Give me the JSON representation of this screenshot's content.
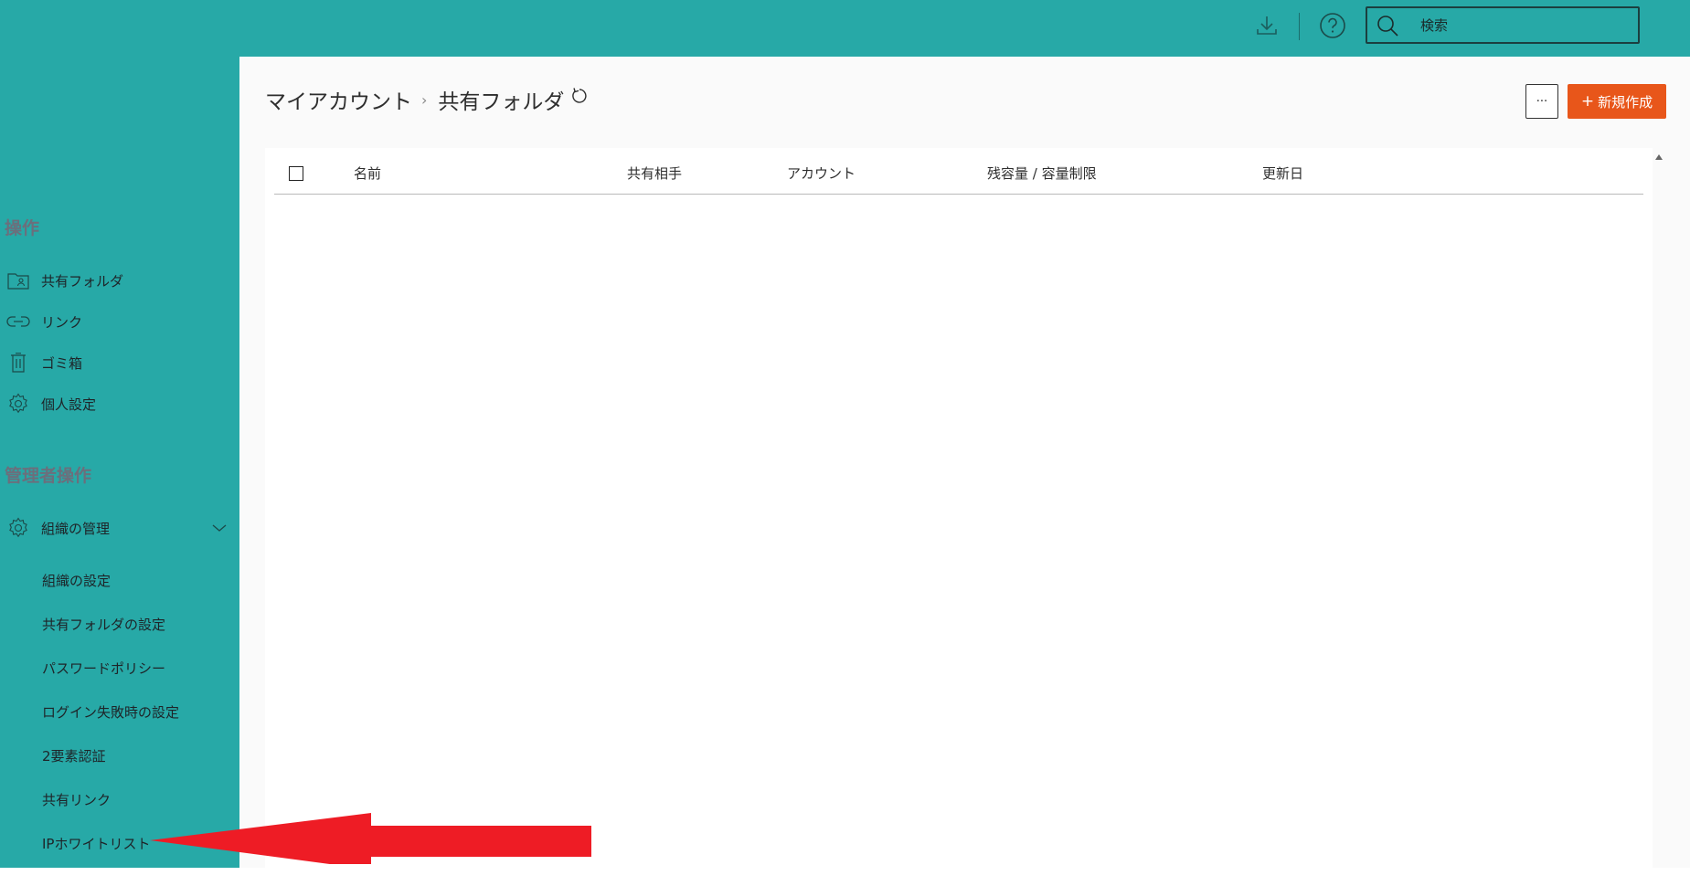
{
  "topbar": {
    "search_placeholder": "検索",
    "download_icon": "download-icon",
    "help_icon": "help-circle-icon",
    "search_icon": "search-icon"
  },
  "sidebar": {
    "section_operations": "操作",
    "items": [
      {
        "label": "共有フォルダ",
        "icon": "shared-folder-icon"
      },
      {
        "label": "リンク",
        "icon": "link-icon"
      },
      {
        "label": "ゴミ箱",
        "icon": "trash-icon"
      },
      {
        "label": "個人設定",
        "icon": "gear-icon"
      }
    ],
    "section_admin": "管理者操作",
    "org_manage": {
      "label": "組織の管理",
      "icon": "gear-icon",
      "expanded": true
    },
    "sub_items": [
      "組織の設定",
      "共有フォルダの設定",
      "パスワードポリシー",
      "ログイン失敗時の設定",
      "2要素認証",
      "共有リンク",
      "IPホワイトリスト"
    ]
  },
  "main": {
    "breadcrumb": {
      "root": "マイアカウント",
      "separator": "›",
      "current": "共有フォルダ"
    },
    "more_label": "···",
    "new_button": {
      "plus": "+",
      "label": "新規作成"
    },
    "table": {
      "columns": [
        "名前",
        "共有相手",
        "アカウント",
        "残容量 / 容量制限",
        "更新日"
      ],
      "rows": []
    }
  },
  "colors": {
    "brand_teal": "#27a9a7",
    "accent_orange": "#e8561a",
    "annotation_red": "#ee1c25",
    "section_title": "#6b6f7c"
  }
}
